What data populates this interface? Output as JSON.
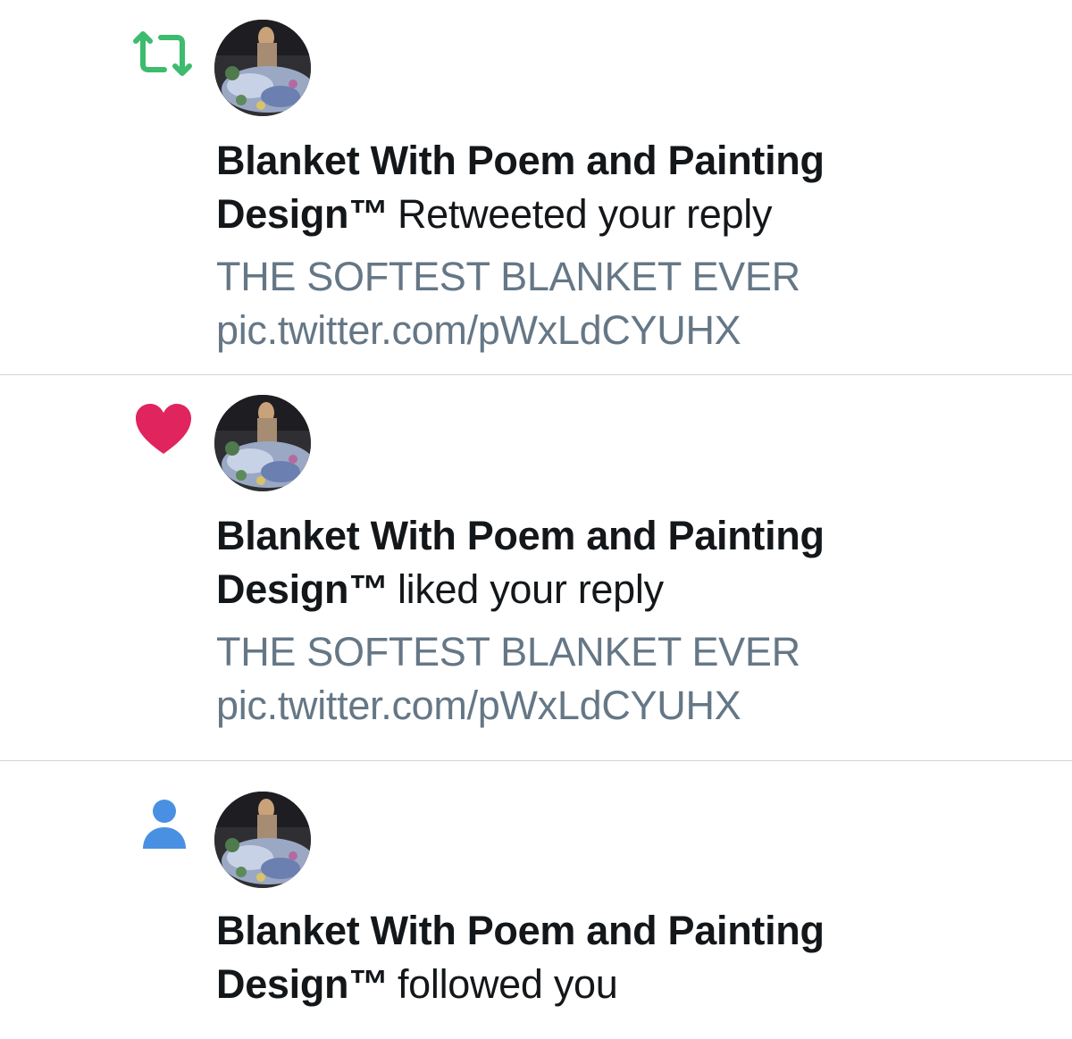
{
  "notifications": [
    {
      "type": "retweet",
      "icon": "retweet-icon",
      "icon_color": "#3dbb6e",
      "user_name": "Blanket With Poem and Painting Design™",
      "action": "Retweeted your reply",
      "tweet_lines": [
        "THE SOFTEST BLANKET EVER",
        "pic.twitter.com/pWxLdCYUHX"
      ]
    },
    {
      "type": "like",
      "icon": "heart-icon",
      "icon_color": "#e0245e",
      "user_name": "Blanket With Poem and Painting Design™",
      "action": "liked your reply",
      "tweet_lines": [
        "THE SOFTEST BLANKET EVER",
        "pic.twitter.com/pWxLdCYUHX"
      ]
    },
    {
      "type": "follow",
      "icon": "person-icon",
      "icon_color": "#4a90e2",
      "user_name": "Blanket With Poem and Painting Design™",
      "action": "followed you"
    }
  ],
  "colors": {
    "text_primary": "#14171a",
    "text_secondary": "#657786",
    "divider": "#d4d4d4"
  }
}
